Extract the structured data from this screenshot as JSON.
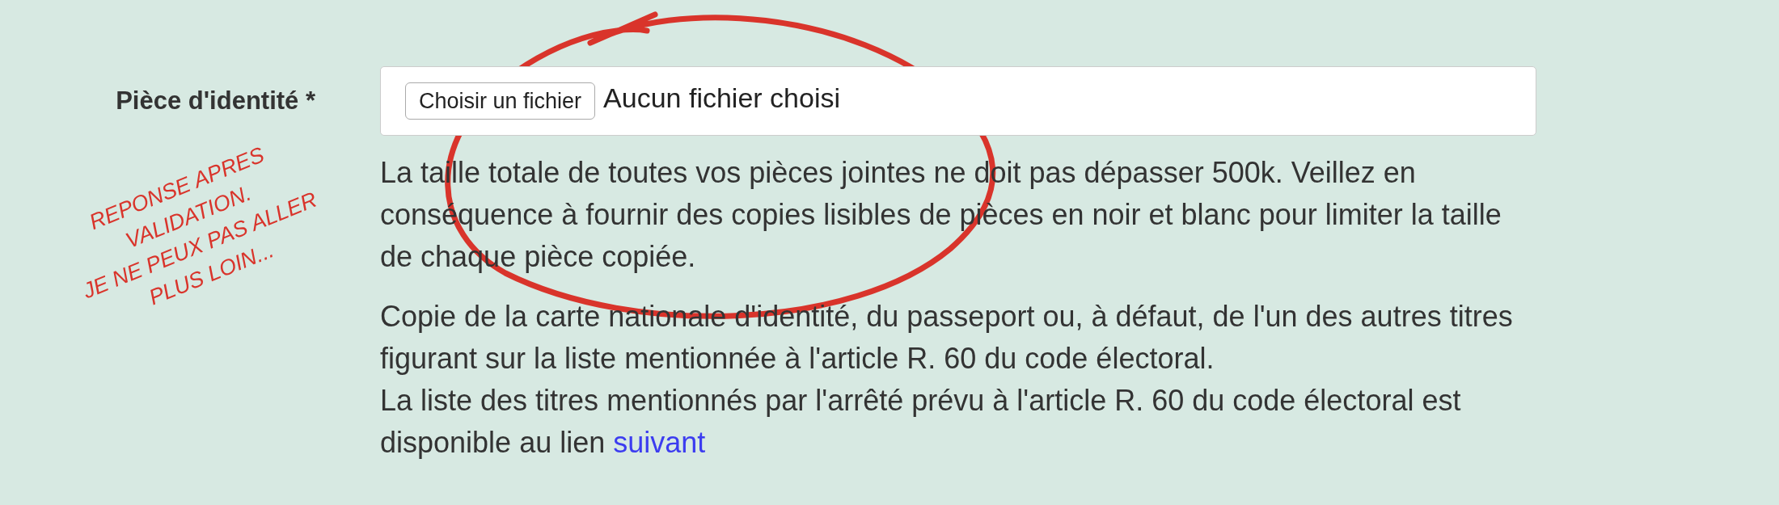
{
  "field": {
    "label": "Pièce d'identité *",
    "button": "Choisir un fichier",
    "value": "Aucun fichier choisi"
  },
  "help": [
    "La taille totale de toutes vos pièces jointes ne doit pas dépasser 500k. Veillez en conséquence à fournir des copies lisibles de pièces en noir et blanc pour limiter la taille de chaque pièce copiée."
  ],
  "notice": {
    "lines": [
      "Copie de la carte nationale d'identité, du passeport ou, à défaut, de l'un des autres titres figurant sur la liste mentionnée à l'article R. 60 du code électoral.",
      "La liste des titres mentionnés par l'arrêté prévu à l'article R. 60 du code électoral est disponible au lien"
    ],
    "link": "suivant"
  },
  "annotation": {
    "lines": [
      "REPONSE APRES",
      "VALIDATION.",
      "JE NE PEUX PAS ALLER",
      "PLUS LOIN..."
    ]
  }
}
